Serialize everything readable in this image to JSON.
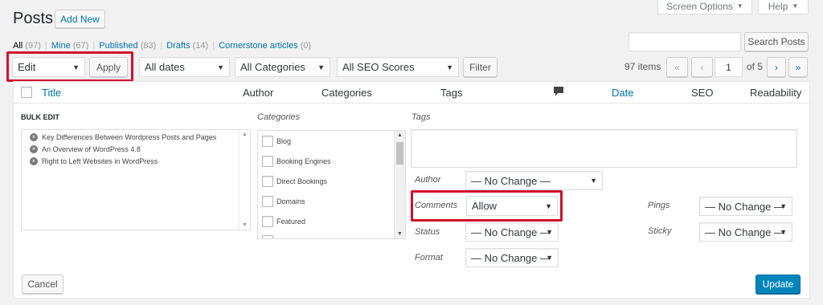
{
  "header": {
    "title": "Posts",
    "add_new": "Add New",
    "screen_options": "Screen Options",
    "help": "Help"
  },
  "filters": {
    "all": "All",
    "all_count": "(97)",
    "mine": "Mine",
    "mine_count": "(67)",
    "published": "Published",
    "published_count": "(83)",
    "drafts": "Drafts",
    "drafts_count": "(14)",
    "cornerstone": "Cornerstone articles",
    "cornerstone_count": "(0)",
    "sep": "|"
  },
  "search": {
    "button": "Search Posts",
    "value": ""
  },
  "toolbar": {
    "bulk_action": "Edit",
    "apply": "Apply",
    "dates": "All dates",
    "categories": "All Categories",
    "seo_scores": "All SEO Scores",
    "filter": "Filter"
  },
  "pagination": {
    "items": "97 items",
    "first": "«",
    "prev": "‹",
    "page": "1",
    "of": "of 5",
    "next": "›",
    "last": "»"
  },
  "table_header": {
    "title": "Title",
    "author": "Author",
    "categories": "Categories",
    "tags": "Tags",
    "date": "Date",
    "seo": "SEO",
    "readability": "Readability"
  },
  "bulk_edit": {
    "heading": "BULK EDIT",
    "posts": [
      "Key Differences Between Wordpress Posts and Pages",
      "An Overview of WordPress 4.8",
      "Right to Left Websites in WordPress"
    ],
    "categories_label": "Categories",
    "categories": [
      "Blog",
      "Booking Engines",
      "Direct Bookings",
      "Domains",
      "Featured"
    ],
    "tags_label": "Tags",
    "author_label": "Author",
    "author_value": "— No Change —",
    "comments_label": "Comments",
    "comments_value": "Allow",
    "status_label": "Status",
    "status_value": "— No Change —",
    "format_label": "Format",
    "format_value": "— No Change —",
    "pings_label": "Pings",
    "pings_value": "— No Change —",
    "sticky_label": "Sticky",
    "sticky_value": "— No Change —",
    "cancel": "Cancel",
    "update": "Update"
  },
  "colors": {
    "highlight": "#d0112b",
    "primary": "#0085ba",
    "link": "#0073aa"
  },
  "icons": {
    "dropdown": "▼",
    "select_arrow": "▾",
    "remove": "×",
    "comment": "comment-bubble-icon",
    "scroll_up": "▲",
    "scroll_down": "▼"
  }
}
